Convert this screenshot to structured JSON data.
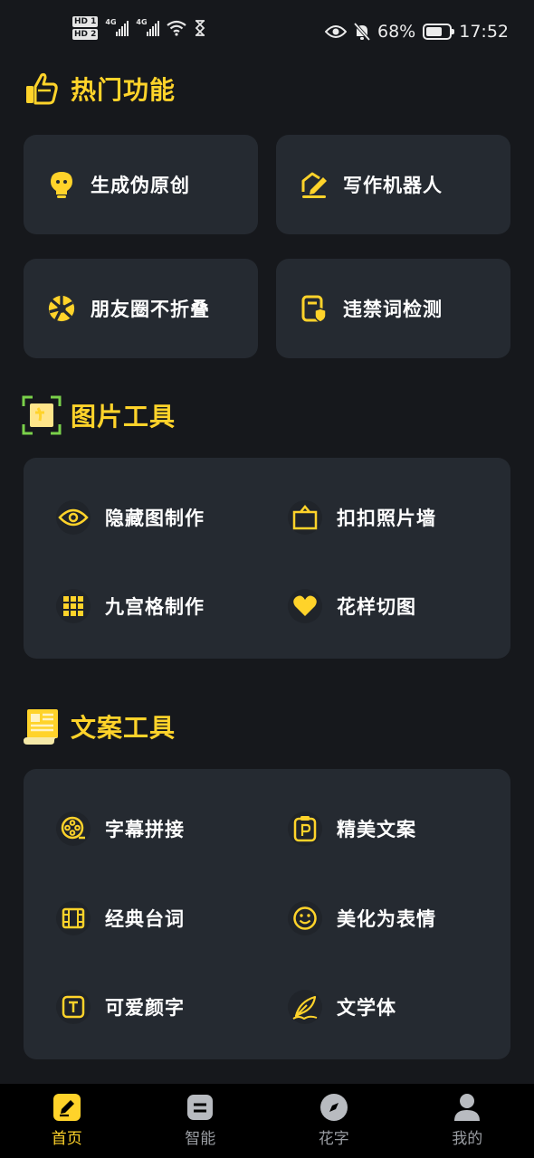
{
  "status_bar": {
    "hd1": "HD 1",
    "hd2": "HD 2",
    "network1": "4G",
    "network2": "4G",
    "battery_percent": "68%",
    "battery_level": 0.68,
    "time": "17:52"
  },
  "colors": {
    "accent": "#ffd32a",
    "background": "#16181c",
    "card": "#252a31",
    "nav_bg": "#000000"
  },
  "hot_section": {
    "title": "热门功能",
    "icon": "thumbs-up-icon",
    "items": [
      {
        "label": "生成伪原创",
        "icon": "lightbulb-icon"
      },
      {
        "label": "写作机器人",
        "icon": "writing-pen-icon"
      },
      {
        "label": "朋友圈不折叠",
        "icon": "aperture-icon"
      },
      {
        "label": "违禁词检测",
        "icon": "shield-check-icon"
      }
    ]
  },
  "image_section": {
    "title": "图片工具",
    "icon": "picture-frame-icon",
    "items": [
      {
        "label": "隐藏图制作",
        "icon": "eye-icon"
      },
      {
        "label": "扣扣照片墙",
        "icon": "photo-wall-icon"
      },
      {
        "label": "九宫格制作",
        "icon": "grid-icon"
      },
      {
        "label": "花样切图",
        "icon": "heart-icon"
      }
    ]
  },
  "text_section": {
    "title": "文案工具",
    "icon": "document-icon",
    "items": [
      {
        "label": "字幕拼接",
        "icon": "film-reel-icon"
      },
      {
        "label": "精美文案",
        "icon": "parking-badge-icon"
      },
      {
        "label": "经典台词",
        "icon": "film-strip-icon"
      },
      {
        "label": "美化为表情",
        "icon": "smiley-icon"
      },
      {
        "label": "可爱颜字",
        "icon": "text-box-icon"
      },
      {
        "label": "文学体",
        "icon": "feather-icon"
      }
    ]
  },
  "bottom_nav": {
    "items": [
      {
        "label": "首页",
        "icon": "edit-icon",
        "active": true
      },
      {
        "label": "智能",
        "icon": "chat-box-icon",
        "active": false
      },
      {
        "label": "花字",
        "icon": "compass-icon",
        "active": false
      },
      {
        "label": "我的",
        "icon": "user-icon",
        "active": false
      }
    ]
  }
}
